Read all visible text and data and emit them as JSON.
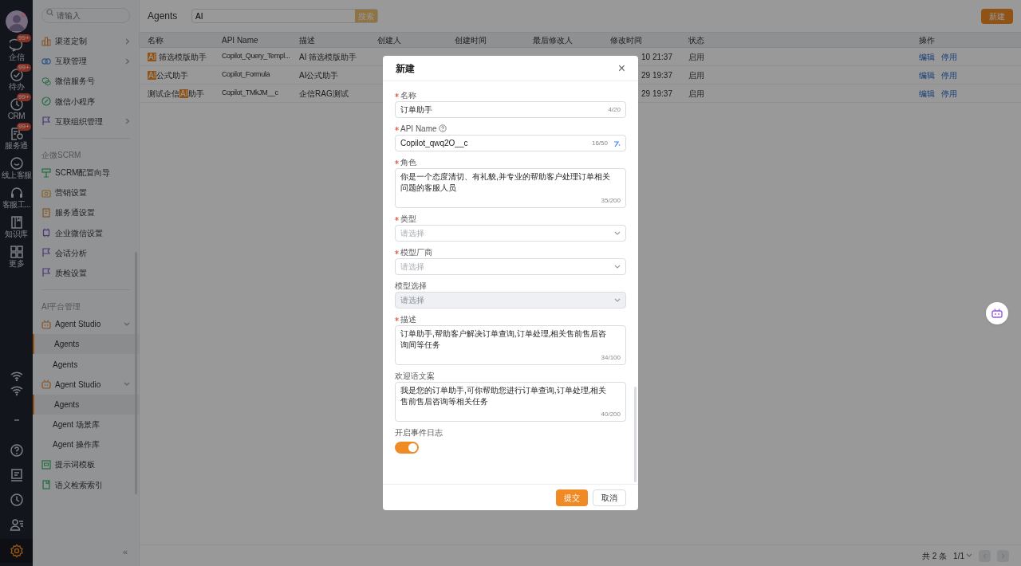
{
  "rail": {
    "items": [
      {
        "label": "企信",
        "badge": "99+"
      },
      {
        "label": "待办",
        "badge": "99+"
      },
      {
        "label": "CRM",
        "badge": "99+"
      },
      {
        "label": "服务通",
        "badge": "99+"
      },
      {
        "label": "线上客服"
      },
      {
        "label": "客服工..."
      },
      {
        "label": "知识库"
      },
      {
        "label": "更多"
      }
    ],
    "bottom": [
      {
        "selected": false
      },
      {
        "selected": false
      },
      {
        "selected": false
      },
      {
        "selected": false
      },
      {
        "selected": false
      },
      {
        "selected": false
      },
      {
        "selected": false
      },
      {
        "selected": true
      }
    ]
  },
  "sidebar": {
    "search_placeholder": "请输入",
    "sections": [
      {
        "items": [
          {
            "label": "渠道定制",
            "kind": "item",
            "arrow": true
          },
          {
            "label": "互联管理",
            "kind": "item",
            "arrow": true
          },
          {
            "label": "微信服务号",
            "kind": "item",
            "arrow": false
          },
          {
            "label": "微信小程序",
            "kind": "item",
            "arrow": false
          },
          {
            "label": "互联组织管理",
            "kind": "item",
            "arrow": true
          }
        ]
      },
      {
        "title": "企微SCRM",
        "items": [
          {
            "label": "SCRM配置向导",
            "kind": "item"
          },
          {
            "label": "营销设置",
            "kind": "item"
          },
          {
            "label": "服务通设置",
            "kind": "item"
          },
          {
            "label": "企业微信设置",
            "kind": "item"
          },
          {
            "label": "会话分析",
            "kind": "item"
          },
          {
            "label": "质检设置",
            "kind": "item"
          }
        ]
      },
      {
        "title": "AI平台管理",
        "items": [
          {
            "label": "Agent Studio",
            "kind": "group"
          },
          {
            "label": "Agents",
            "kind": "sub",
            "selected": true
          },
          {
            "label": "Agents",
            "kind": "sub",
            "selected": false
          },
          {
            "label": "Agent Studio",
            "kind": "group"
          },
          {
            "label": "Agents",
            "kind": "sub",
            "selected": true
          },
          {
            "label": "Agent 场景库",
            "kind": "sub",
            "selected": false
          },
          {
            "label": "Agent 操作库",
            "kind": "sub",
            "selected": false
          },
          {
            "label": "提示词模板",
            "kind": "item"
          },
          {
            "label": "语义检索索引",
            "kind": "item"
          }
        ]
      }
    ],
    "collapse": "«"
  },
  "main": {
    "title": "Agents",
    "search_value": "AI",
    "search_button": "搜索",
    "new_button": "新建",
    "table": {
      "columns": [
        "名称",
        "API Name",
        "描述",
        "创建人",
        "创建时间",
        "最后修改人",
        "修改时间",
        "状态",
        "操作"
      ],
      "rows": [
        {
          "name": [
            {
              "text": "AI",
              "highlight": true
            },
            {
              "text": " 筛选模版助手",
              "highlight": false
            }
          ],
          "api": "Copilot_Query_Templ...",
          "desc": "AI 筛选模版助手",
          "modified": "10 21:37",
          "status": "启用",
          "actions": [
            "编辑",
            "停用"
          ]
        },
        {
          "name": [
            {
              "text": "AI",
              "highlight": true
            },
            {
              "text": "公式助手",
              "highlight": false
            }
          ],
          "api": "Copilot_Formula",
          "desc": "AI公式助手",
          "modified": "29 19:37",
          "status": "启用",
          "actions": [
            "编辑",
            "停用"
          ]
        },
        {
          "name": [
            {
              "text": "测试企信",
              "highlight": false
            },
            {
              "text": "AI",
              "highlight": true
            },
            {
              "text": "助手",
              "highlight": false
            }
          ],
          "api": "Copilot_TMkJM__c",
          "desc": "企信RAG测试",
          "modified": "29 19:37",
          "status": "启用",
          "actions": [
            "编辑",
            "停用"
          ]
        }
      ]
    },
    "pagination": {
      "total": "共 2 条",
      "page": "1/1"
    }
  },
  "modal": {
    "title": "新建",
    "close": "×",
    "fields": [
      {
        "kind": "input",
        "label": "名称",
        "required": true,
        "value": "订单助手",
        "counter": "4/20"
      },
      {
        "kind": "input",
        "label": "API Name",
        "required": true,
        "help": true,
        "value": "Copilot_qwq2O__c",
        "counter": "16/50",
        "magic": true
      },
      {
        "kind": "textarea",
        "label": "角色",
        "required": true,
        "value": "你是一个态度清切、有礼貌,并专业的帮助客户处理订单相关问题的客服人员",
        "counter": "35/200"
      },
      {
        "kind": "select",
        "label": "类型",
        "required": true,
        "placeholder": "请选择",
        "disabled": false
      },
      {
        "kind": "select",
        "label": "模型厂商",
        "required": true,
        "placeholder": "请选择",
        "disabled": false
      },
      {
        "kind": "select",
        "label": "模型选择",
        "required": false,
        "placeholder": "请选择",
        "disabled": true
      },
      {
        "kind": "textarea",
        "label": "描述",
        "required": true,
        "value": "订单助手,帮助客户解决订单查询,订单处理,相关售前售后咨询间等任务",
        "counter": "34/100"
      },
      {
        "kind": "textarea",
        "label": "欢迎语文案",
        "required": false,
        "value": "我是您的订单助手,可你帮助您进行订单查询,订单处理,相关售前售后咨询等相关任务",
        "counter": "40/200"
      },
      {
        "kind": "toggle",
        "label": "开启事件日志",
        "required": false,
        "on": true
      }
    ],
    "submit": "提交",
    "cancel": "取消"
  }
}
